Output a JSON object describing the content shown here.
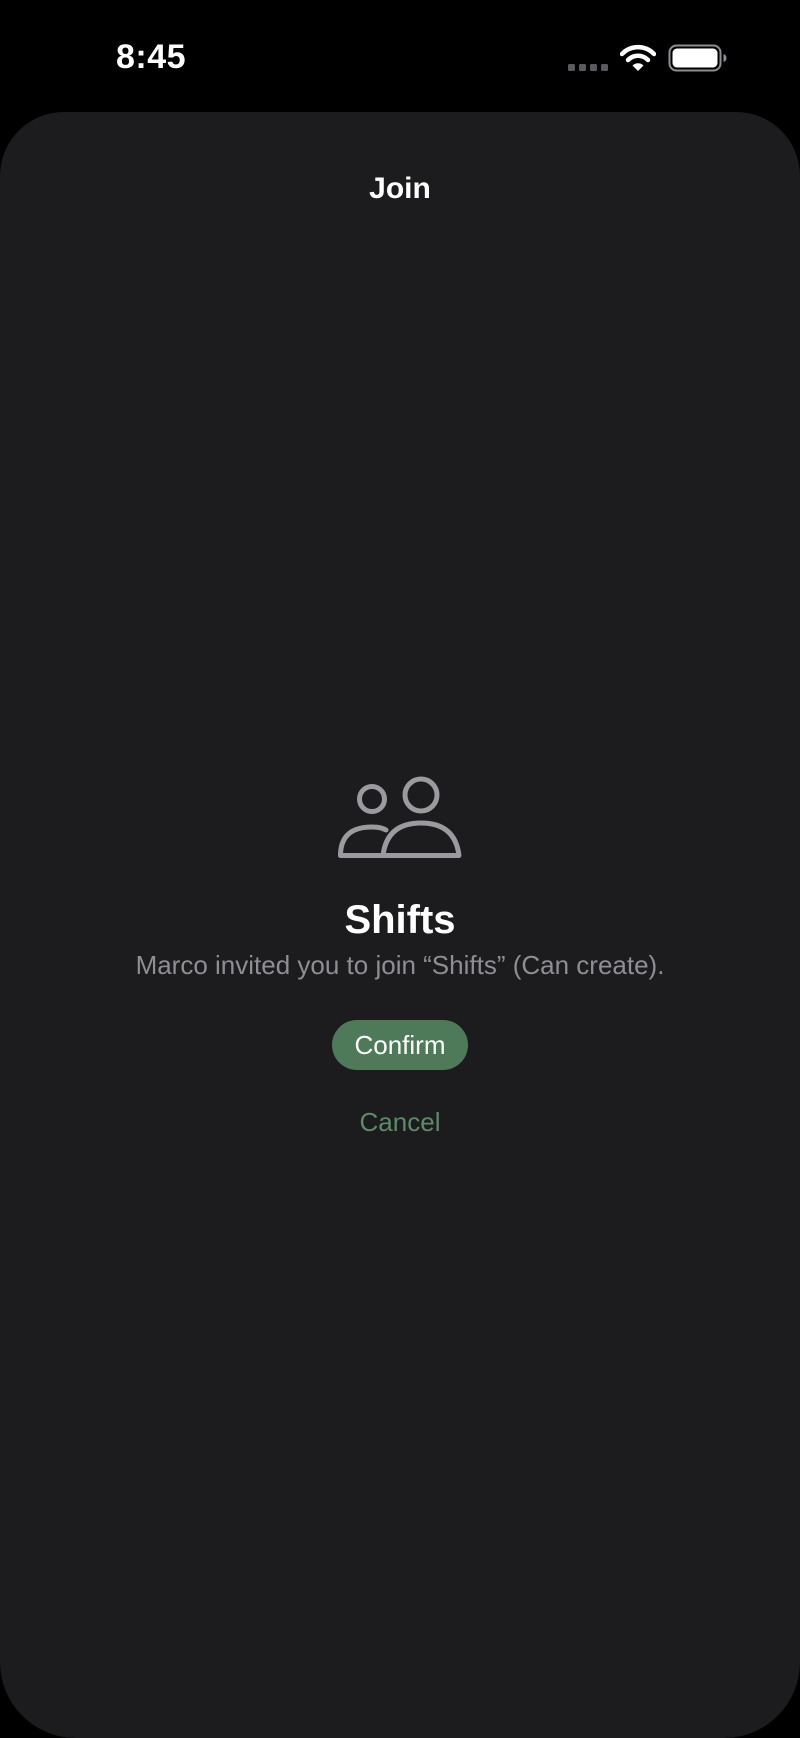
{
  "status_bar": {
    "time": "8:45"
  },
  "sheet": {
    "title": "Join",
    "group_icon": "two-people-icon",
    "group_name": "Shifts",
    "invite_message": "Marco invited you to join “Shifts” (Can create).",
    "confirm_label": "Confirm",
    "cancel_label": "Cancel"
  },
  "colors": {
    "background": "#000000",
    "sheet_background": "#1c1c1e",
    "accent": "#4e7a5a",
    "cancel_text": "#5e8a68",
    "secondary_text": "#8e8e93",
    "icon": "#9a9a9f"
  }
}
